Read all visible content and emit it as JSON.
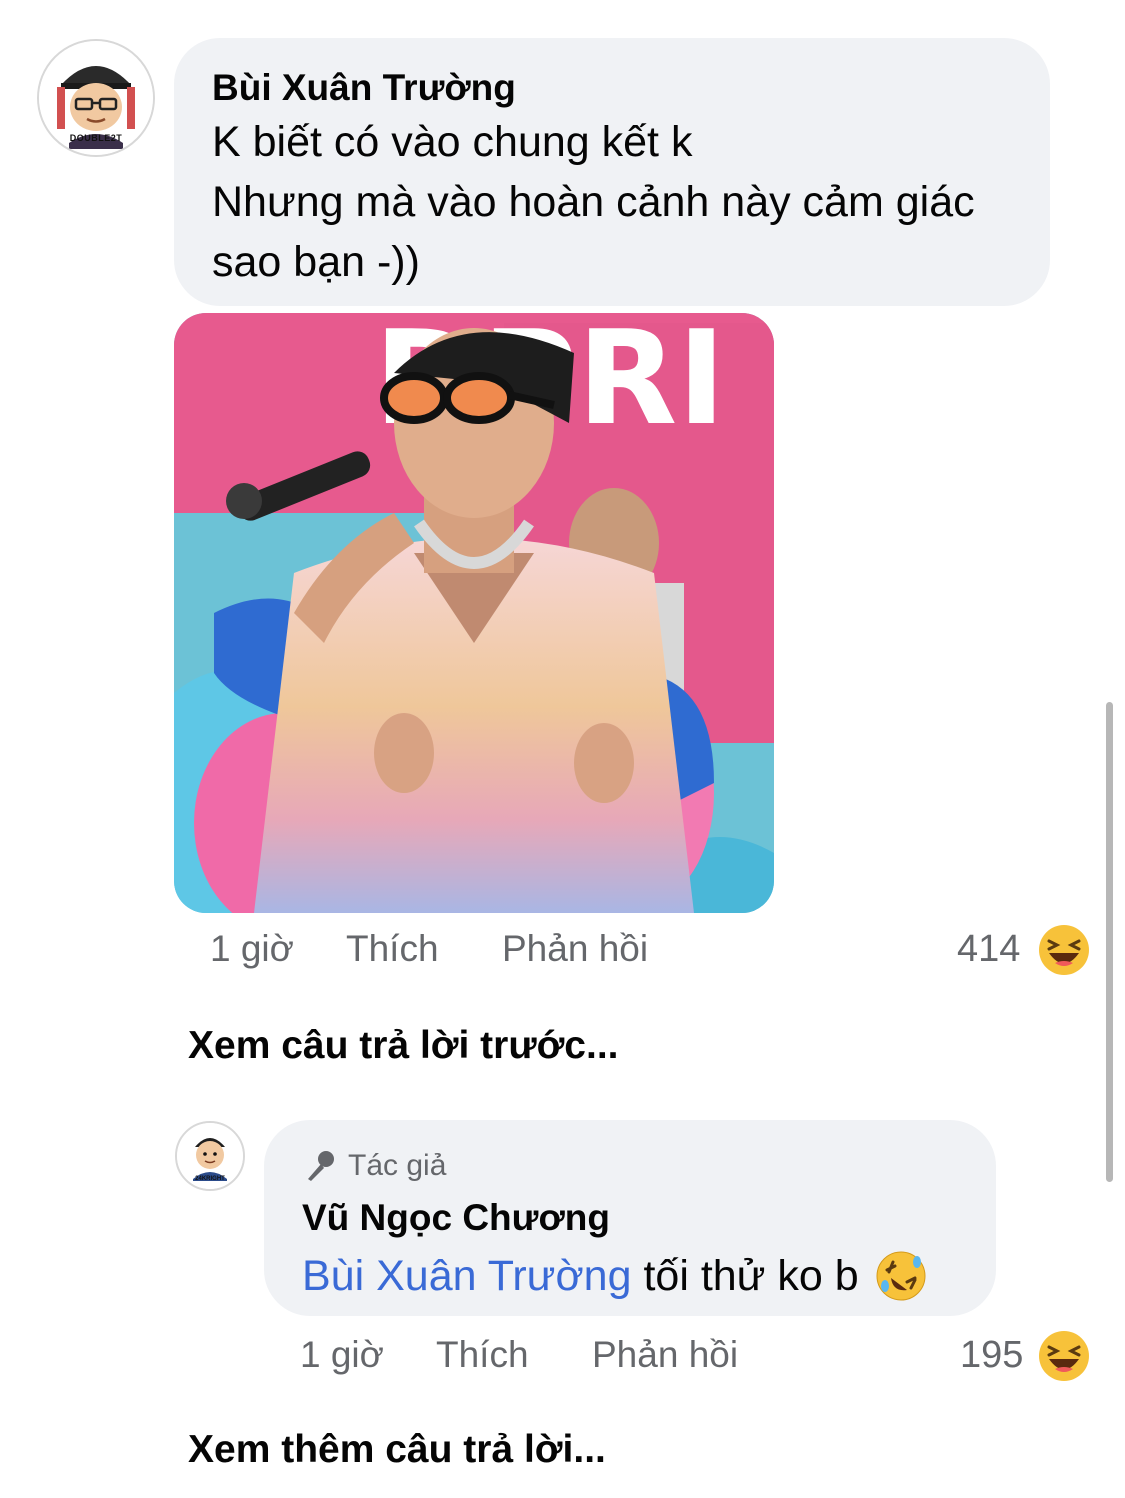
{
  "comment": {
    "author": "Bùi Xuân Trường",
    "avatar_label": "DOUBLE2T",
    "lines": [
      "K biết có vào chung kết k",
      "Nhưng mà vào hoàn cảnh này cảm giác",
      "sao bạn -))"
    ],
    "photo_icon": "photo-performer-microphone",
    "time": "1 giờ",
    "like_label": "Thích",
    "reply_label": "Phản hồi",
    "reaction_count": "414",
    "reaction_icon": "laughing-face-icon"
  },
  "view_previous": "Xem câu trả lời trước...",
  "reply": {
    "avatar_label": "24KRIGHT",
    "badge_icon": "microphone-icon",
    "badge_label": "Tác giả",
    "author": "Vũ Ngọc Chương",
    "mention": "Bùi Xuân Trường",
    "text": "tối thử ko b",
    "emoji_icon": "rolling-laughing-face-icon",
    "time": "1 giờ",
    "like_label": "Thích",
    "reply_label": "Phản hồi",
    "reaction_count": "195",
    "reaction_icon": "laughing-face-icon"
  },
  "view_more": "Xem thêm câu trả lời..."
}
